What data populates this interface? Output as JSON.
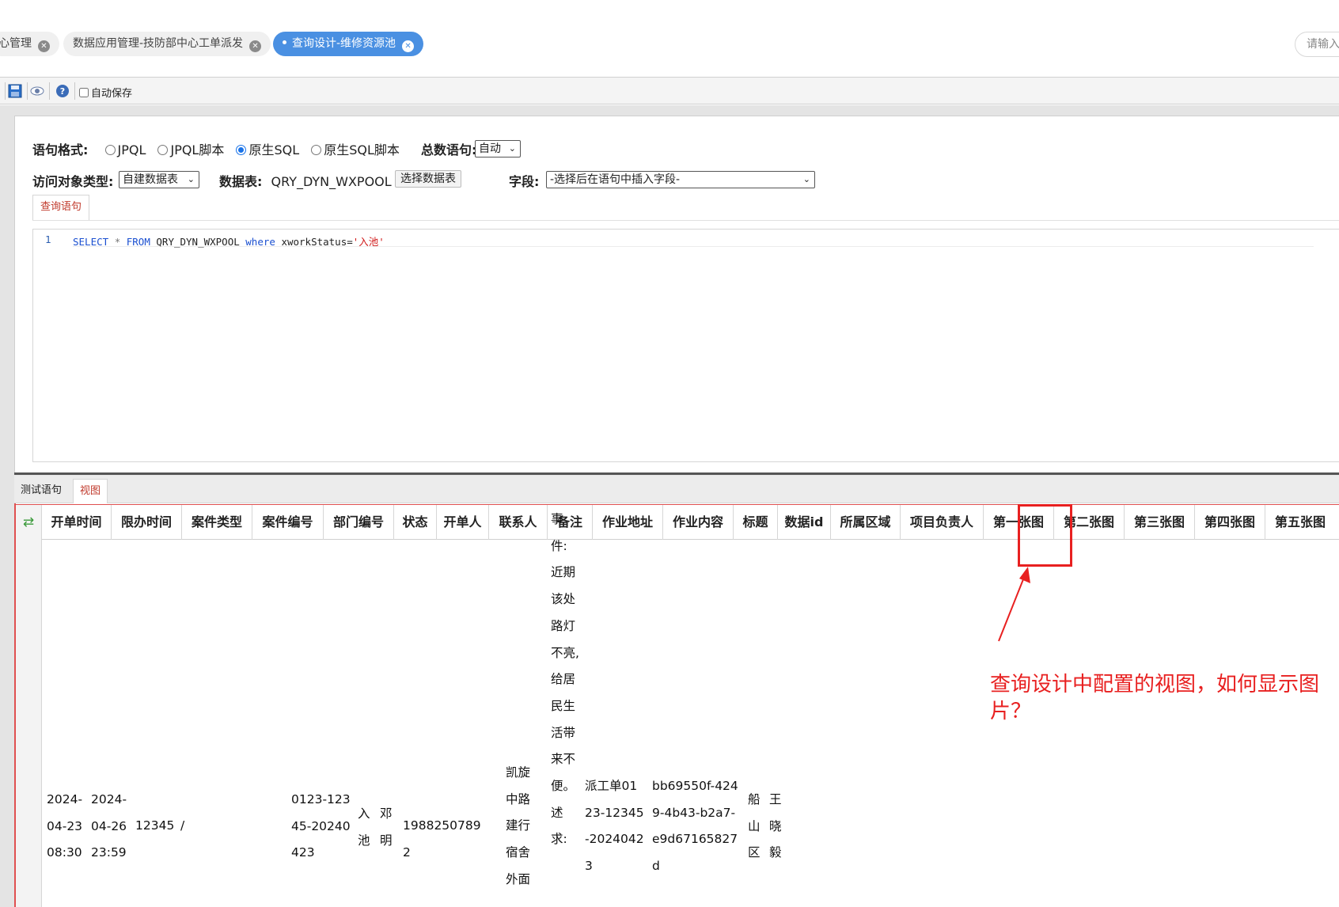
{
  "tabs": [
    {
      "label": "心管理",
      "active": false
    },
    {
      "label": "数据应用管理-技防部中心工单派发",
      "active": false
    },
    {
      "label": "查询设计-维修资源池",
      "active": true
    }
  ],
  "search_placeholder": "请输入",
  "toolbar": {
    "save_icon": "save-icon",
    "preview_icon": "eye-icon",
    "help_icon": "help-icon",
    "autosave_label": "自动保存",
    "autosave_checked": false
  },
  "form": {
    "syntax_label": "语句格式:",
    "syntax_options": [
      "JPQL",
      "JPQL脚本",
      "原生SQL",
      "原生SQL脚本"
    ],
    "syntax_selected": "原生SQL",
    "count_label": "总数语句:",
    "count_value": "自动",
    "access_label": "访问对象类型:",
    "access_value": "自建数据表",
    "table_label": "数据表:",
    "table_value": "QRY_DYN_WXPOOL",
    "choose_table_button": "选择数据表",
    "field_label": "字段:",
    "field_value": "-选择后在语句中插入字段-"
  },
  "editor": {
    "tab_label": "查询语句",
    "line_number": "1",
    "tokens": {
      "select": "SELECT",
      "star": "*",
      "from": "FROM",
      "table": "QRY_DYN_WXPOOL",
      "where": "where",
      "cond": "xworkStatus=",
      "value": "'入池'"
    }
  },
  "bottom_tabs": [
    {
      "label": "测试语句",
      "active": false
    },
    {
      "label": "视图",
      "active": true
    }
  ],
  "grid": {
    "columns": [
      "开单时间",
      "限办时间",
      "案件类型",
      "案件编号",
      "部门编号",
      "状态",
      "开单人",
      "联系人",
      "备注",
      "作业地址",
      "作业内容",
      "标题",
      "数据id",
      "所属区域",
      "项目负责人",
      "第一张图",
      "第二张图",
      "第三张图",
      "第四张图",
      "第五张图"
    ],
    "row": {
      "open_time": "2024-04-23 08:30",
      "deadline": "2024-04-26 23:59",
      "case_type": "12345",
      "case_no": "/",
      "dept_no": "0123-12345-20240423",
      "status": "入池",
      "opener": "邓明",
      "contact": "19882507892",
      "remark": "凯旋中路建行宿舍外面",
      "address": "事件:近期该处路灯不亮,给居民生活带来不便。述求:",
      "content": "派工单0123-12345-20240423",
      "title": "bb69550f-4249-4b43-b2a7-e9d67165827d",
      "data_id": "船山区",
      "area": "王晓毅"
    }
  },
  "annotation": {
    "text": "查询设计中配置的视图，如何显示图片？",
    "color": "#e82020"
  }
}
